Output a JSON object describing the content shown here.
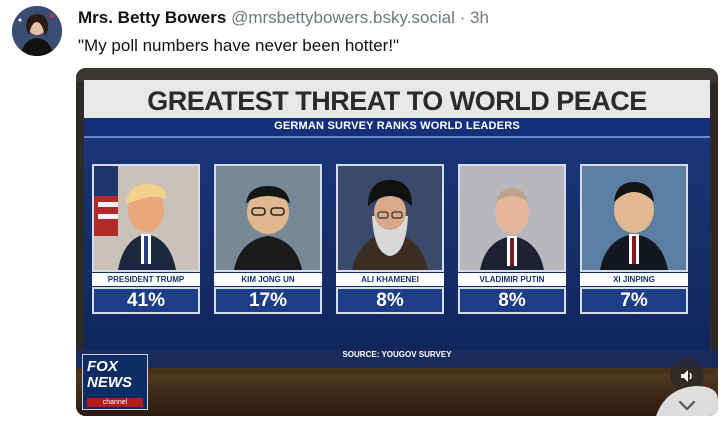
{
  "post": {
    "author_name": "Mrs. Betty Bowers",
    "handle": "@mrsbettybowers.bsky.social",
    "separator": "·",
    "time": "3h",
    "text": "\"My poll numbers have never been hotter!\""
  },
  "media": {
    "title": "GREATEST THREAT TO WORLD PEACE",
    "subtitle": "GERMAN SURVEY RANKS WORLD LEADERS",
    "source": "SOURCE: YOUGOV SURVEY",
    "network_logo_line1": "FOX",
    "network_logo_line2": "NEWS",
    "network_logo_line3": "channel",
    "leaders": [
      {
        "name": "PRESIDENT TRUMP",
        "percent": "41%"
      },
      {
        "name": "KIM JONG UN",
        "percent": "17%"
      },
      {
        "name": "ALI KHAMENEI",
        "percent": "8%"
      },
      {
        "name": "VLADIMIR PUTIN",
        "percent": "8%"
      },
      {
        "name": "XI JINPING",
        "percent": "7%"
      }
    ]
  },
  "icons": {
    "sound": "speaker-icon",
    "expand": "chevron-down-icon"
  }
}
